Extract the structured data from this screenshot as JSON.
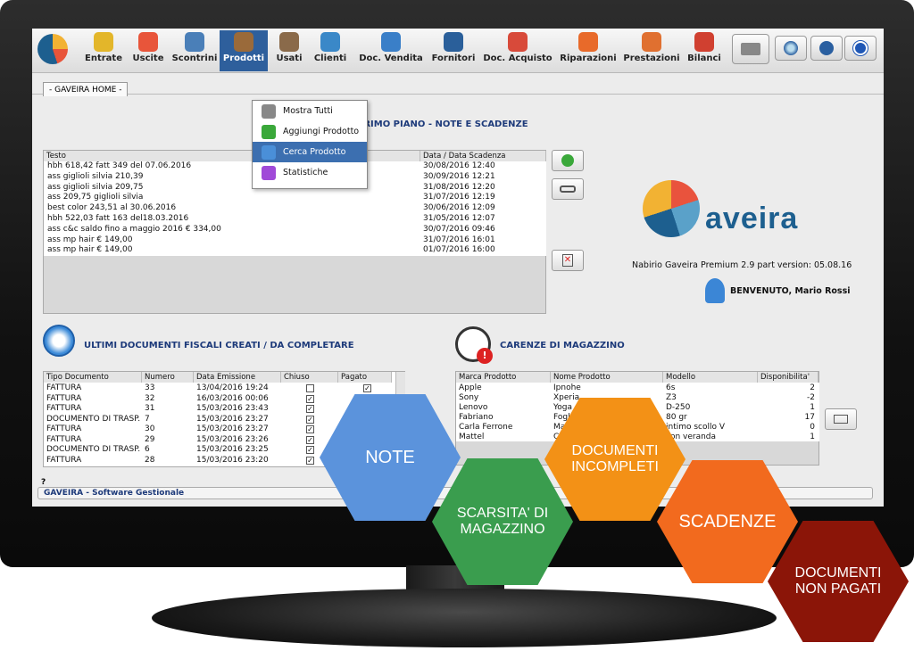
{
  "toolbar": {
    "items": [
      "Entrate",
      "Uscite",
      "Scontrini",
      "Prodotti",
      "Usati",
      "Clienti",
      "Doc. Vendita",
      "Fornitori",
      "Doc. Acquisto",
      "Riparazioni",
      "Prestazioni",
      "Bilanci"
    ],
    "icons": [
      "coin-in-icon",
      "coin-out-icon",
      "receipt-icon",
      "box-icon",
      "used-box-icon",
      "customers-icon",
      "sale-document-icon",
      "suppliers-icon",
      "purchase-document-icon",
      "repairs-icon",
      "services-icon",
      "balance-icon"
    ]
  },
  "tab": {
    "home": "- GAVEIRA HOME -"
  },
  "menu": {
    "items": [
      "Mostra Tutti",
      "Aggiungi Prodotto",
      "Cerca Prodotto",
      "Statistiche"
    ],
    "selected": 2
  },
  "notes": {
    "title": "PRIMO PIANO  -  NOTE E SCADENZE",
    "col_text": "Testo",
    "col_date": "Data / Data Scadenza",
    "rows": [
      {
        "text": "hbh 618,42 fatt 349 del 07.06.2016",
        "date": "30/08/2016 12:40"
      },
      {
        "text": "ass giglioli silvia 210,39",
        "date": "30/09/2016 12:21"
      },
      {
        "text": "ass giglioli silvia 209,75",
        "date": "31/08/2016 12:20"
      },
      {
        "text": "ass 209,75 giglioli silvia",
        "date": "31/07/2016 12:19"
      },
      {
        "text": "best color 243,51 al 30.06.2016",
        "date": "30/06/2016 12:09"
      },
      {
        "text": "hbh 522,03 fatt 163 del18.03.2016",
        "date": "31/05/2016 12:07"
      },
      {
        "text": "ass c&c saldo fino a maggio 2016 € 334,00",
        "date": "30/07/2016 09:46"
      },
      {
        "text": "ass mp hair € 149,00",
        "date": "31/07/2016 16:01"
      },
      {
        "text": "ass mp hair € 149,00",
        "date": "01/07/2016 16:00"
      }
    ]
  },
  "brand": {
    "logo_text": "aveira",
    "version": "Nabirio Gaveira Premium 2.9 part version: 05.08.16",
    "welcome": "BENVENUTO, Mario Rossi"
  },
  "docs": {
    "title": "ULTIMI DOCUMENTI FISCALI CREATI / DA COMPLETARE",
    "cols": [
      "Tipo Documento",
      "Numero",
      "Data Emissione",
      "Chiuso",
      "Pagato"
    ],
    "rows": [
      {
        "tipo": "FATTURA",
        "num": "33",
        "data": "13/04/2016 19:24",
        "chiuso": false,
        "pagato": true
      },
      {
        "tipo": "FATTURA",
        "num": "32",
        "data": "16/03/2016 00:06",
        "chiuso": true,
        "pagato": true
      },
      {
        "tipo": "FATTURA",
        "num": "31",
        "data": "15/03/2016 23:43",
        "chiuso": true,
        "pagato": true
      },
      {
        "tipo": "DOCUMENTO DI TRASP...",
        "num": "7",
        "data": "15/03/2016 23:27",
        "chiuso": true,
        "pagato": false
      },
      {
        "tipo": "FATTURA",
        "num": "30",
        "data": "15/03/2016 23:27",
        "chiuso": true,
        "pagato": false
      },
      {
        "tipo": "FATTURA",
        "num": "29",
        "data": "15/03/2016 23:26",
        "chiuso": true,
        "pagato": false
      },
      {
        "tipo": "DOCUMENTO DI TRASP...",
        "num": "6",
        "data": "15/03/2016 23:25",
        "chiuso": true,
        "pagato": false
      },
      {
        "tipo": "FATTURA",
        "num": "28",
        "data": "15/03/2016 23:20",
        "chiuso": true,
        "pagato": false
      }
    ]
  },
  "stock": {
    "title": "CARENZE DI MAGAZZINO",
    "cols": [
      "Marca Prodotto",
      "Nome Prodotto",
      "Modello",
      "Disponibilita'"
    ],
    "rows": [
      {
        "marca": "Apple",
        "nome": "Ipnohe",
        "modello": "6s",
        "disp": "2"
      },
      {
        "marca": "Sony",
        "nome": "Xperia",
        "modello": "Z3",
        "disp": "-2"
      },
      {
        "marca": "Lenovo",
        "nome": "Yoga",
        "modello": "D-250",
        "disp": "1"
      },
      {
        "marca": "Fabriano",
        "nome": "Fogl",
        "modello": "80 gr",
        "disp": "17"
      },
      {
        "marca": "Carla Ferrone",
        "nome": "Ma",
        "modello": "intimo scollo V",
        "disp": "0"
      },
      {
        "marca": "Mattel",
        "nome": "C",
        "modello": "con veranda",
        "disp": "1"
      }
    ]
  },
  "status": {
    "help": "?",
    "footer": "GAVEIRA - Software Gestionale"
  },
  "hexes": [
    {
      "label": "NOTE",
      "color": "#5b93dc"
    },
    {
      "label": "SCARSITA' DI MAGAZZINO",
      "color": "#3a9d4e"
    },
    {
      "label": "DOCUMENTI INCOMPLETI",
      "color": "#f39116"
    },
    {
      "label": "SCADENZE",
      "color": "#f26a1e"
    },
    {
      "label": "DOCUMENTI NON PAGATI",
      "color": "#8b1508"
    }
  ]
}
